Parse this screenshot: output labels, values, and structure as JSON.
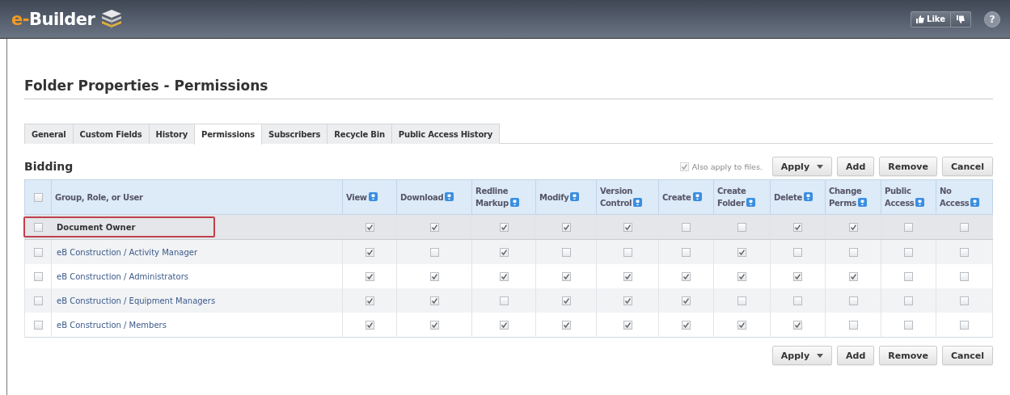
{
  "header": {
    "logo": {
      "prefix": "e-",
      "name": "Builder"
    },
    "like_label": "Like",
    "help_label": "?"
  },
  "page_title": "Folder Properties - Permissions",
  "tabs": [
    {
      "label": "General",
      "selected": false
    },
    {
      "label": "Custom Fields",
      "selected": false
    },
    {
      "label": "History",
      "selected": false
    },
    {
      "label": "Permissions",
      "selected": true
    },
    {
      "label": "Subscribers",
      "selected": false
    },
    {
      "label": "Recycle Bin",
      "selected": false
    },
    {
      "label": "Public Access History",
      "selected": false
    }
  ],
  "section_title": "Bidding",
  "apply_to_files": {
    "label": "Also apply to files.",
    "checked": true
  },
  "top_buttons": [
    {
      "label": "Apply",
      "kind": "dropdown"
    },
    {
      "label": "Add",
      "kind": "plain"
    },
    {
      "label": "Remove",
      "kind": "plain"
    },
    {
      "label": "Cancel",
      "kind": "plain"
    }
  ],
  "table": {
    "select_all_checked": false,
    "name_column": "Group, Role, or User",
    "columns": [
      {
        "line1": "View"
      },
      {
        "line1": "Download"
      },
      {
        "line1": "Redline",
        "line2": "Markup"
      },
      {
        "line1": "Modify"
      },
      {
        "line1": "Version",
        "line2": "Control"
      },
      {
        "line1": "Create"
      },
      {
        "line1": "Create",
        "line2": "Folder"
      },
      {
        "line1": "Delete"
      },
      {
        "line1": "Change",
        "line2": "Perms"
      },
      {
        "line1": "Public",
        "line2": "Access"
      },
      {
        "line1": "No",
        "line2": "Access"
      }
    ],
    "rows": [
      {
        "name": "Document Owner",
        "kind": "owner",
        "checked": false,
        "highlighted": true,
        "outlined": true,
        "permissions": [
          true,
          true,
          true,
          true,
          true,
          false,
          false,
          true,
          true,
          false,
          false
        ]
      },
      {
        "name": "eB Construction / Activity Manager",
        "kind": "group",
        "checked": false,
        "highlighted": false,
        "outlined": false,
        "permissions": [
          true,
          false,
          true,
          false,
          false,
          false,
          true,
          false,
          false,
          false,
          false
        ]
      },
      {
        "name": "eB Construction / Administrators",
        "kind": "group",
        "checked": false,
        "highlighted": false,
        "outlined": false,
        "permissions": [
          true,
          true,
          true,
          true,
          true,
          true,
          true,
          true,
          true,
          false,
          false
        ]
      },
      {
        "name": "eB Construction / Equipment Managers",
        "kind": "group",
        "checked": false,
        "highlighted": false,
        "outlined": false,
        "permissions": [
          true,
          true,
          false,
          true,
          true,
          true,
          false,
          false,
          false,
          false,
          false
        ]
      },
      {
        "name": "eB Construction / Members",
        "kind": "group",
        "checked": false,
        "highlighted": false,
        "outlined": false,
        "permissions": [
          true,
          true,
          true,
          true,
          true,
          true,
          true,
          true,
          false,
          false,
          false
        ]
      }
    ]
  },
  "bottom_buttons": [
    {
      "label": "Apply",
      "kind": "dropdown"
    },
    {
      "label": "Add",
      "kind": "plain"
    },
    {
      "label": "Remove",
      "kind": "plain"
    },
    {
      "label": "Cancel",
      "kind": "plain"
    }
  ]
}
